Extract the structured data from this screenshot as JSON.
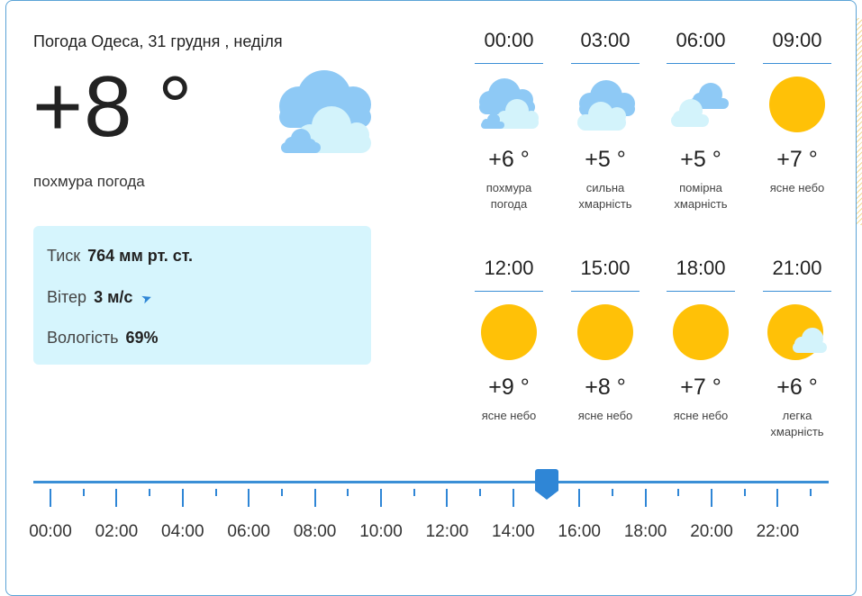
{
  "header": {
    "title": "Погода Одеса, 31 грудня , неділя"
  },
  "current": {
    "temp": "+8 °",
    "condition": "похмура погода",
    "icon": "overcast-cloud-icon"
  },
  "details": {
    "pressure_label": "Тиск",
    "pressure_value": "764 мм рт. ст.",
    "wind_label": "Вітер",
    "wind_value": "3 м/с",
    "humidity_label": "Вологість",
    "humidity_value": "69%"
  },
  "hourly": [
    {
      "time": "00:00",
      "temp": "+6 °",
      "cond1": "похмура",
      "cond2": "погода",
      "icon": "overcast"
    },
    {
      "time": "03:00",
      "temp": "+5 °",
      "cond1": "сильна",
      "cond2": "хмарність",
      "icon": "cloudy"
    },
    {
      "time": "06:00",
      "temp": "+5 °",
      "cond1": "помірна",
      "cond2": "хмарність",
      "icon": "partly"
    },
    {
      "time": "09:00",
      "temp": "+7 °",
      "cond1": "ясне небо",
      "cond2": "",
      "icon": "sun"
    },
    {
      "time": "12:00",
      "temp": "+9 °",
      "cond1": "ясне небо",
      "cond2": "",
      "icon": "sun"
    },
    {
      "time": "15:00",
      "temp": "+8 °",
      "cond1": "ясне небо",
      "cond2": "",
      "icon": "sun"
    },
    {
      "time": "18:00",
      "temp": "+7 °",
      "cond1": "ясне небо",
      "cond2": "",
      "icon": "sun"
    },
    {
      "time": "21:00",
      "temp": "+6 °",
      "cond1": "легка",
      "cond2": "хмарність",
      "icon": "sun-cloud"
    }
  ],
  "timeline": {
    "labels": [
      "00:00",
      "02:00",
      "04:00",
      "06:00",
      "08:00",
      "10:00",
      "12:00",
      "14:00",
      "16:00",
      "18:00",
      "20:00",
      "22:00"
    ],
    "selected_hour": 15,
    "colors": {
      "accent": "#3a8fd6",
      "sun": "#ffc107",
      "cloud_dark": "#8ec9f5",
      "cloud_light": "#d3f3fb"
    }
  }
}
